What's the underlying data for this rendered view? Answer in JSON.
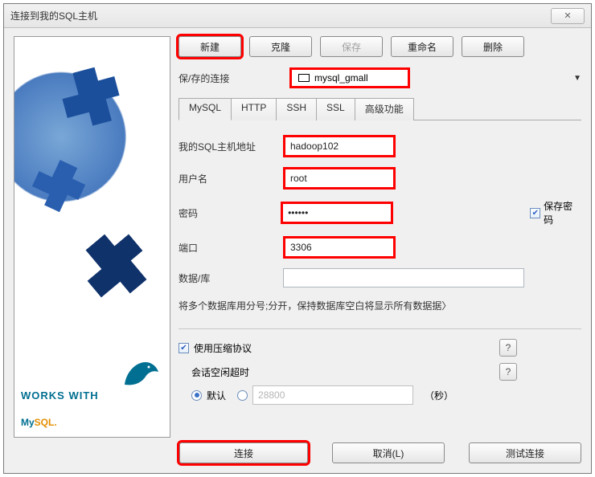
{
  "window": {
    "title": "连接到我的SQL主机"
  },
  "toolbar": {
    "new": "新建",
    "clone": "克隆",
    "save": "保存",
    "rename": "重命名",
    "delete": "删除"
  },
  "saved": {
    "label": "保/存的连接",
    "value": "mysql_gmall"
  },
  "tabs": {
    "mysql": "MySQL",
    "http": "HTTP",
    "ssh": "SSH",
    "ssl": "SSL",
    "advanced": "高级功能"
  },
  "form": {
    "host_label": "我的SQL主机地址",
    "host_value": "hadoop102",
    "user_label": "用户名",
    "user_value": "root",
    "pass_label": "密码",
    "pass_value": "••••••",
    "save_pass_label": "保存密码",
    "port_label": "端口",
    "port_value": "3306",
    "db_label": "数据/库",
    "db_value": "",
    "hint": "将多个数据库用分号;分开，保持数据库空白将显示所有数据据〉"
  },
  "compress": {
    "label": "使用压缩协议",
    "idle_label": "会话空闲超时",
    "default_label": "默认",
    "custom_placeholder": "28800",
    "seconds": "（秒）",
    "help": "?"
  },
  "buttons": {
    "connect": "连接",
    "cancel": "取消(L)",
    "test": "测试连接"
  },
  "logo": {
    "works": "WORKS WITH",
    "my": "My",
    "sql": "SQL"
  }
}
